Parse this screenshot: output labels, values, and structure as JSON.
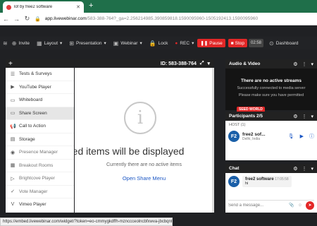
{
  "browser": {
    "tab_title": "lof by free2 software",
    "url_domain": "app.livewebinar.com",
    "url_path": "/583-388-764?_ga=2.256214985.390859818.1590095960-1505192413.1590095960",
    "status_url": "https://embed.livewebinar.com/widget/?token=eo-cmmygkdffh-mznccceolncbfxwva-jbcbqnt#"
  },
  "appbar": {
    "invite": "Invite",
    "layout": "Layout",
    "presentation": "Presentation",
    "webinar": "Webinar",
    "lock": "Lock",
    "rec": "REC",
    "pause": "Pause",
    "stop": "Stop",
    "timer": "02:58",
    "dashboard": "Dashboard"
  },
  "left_panel": {
    "items": [
      {
        "label": "Tests & Surveys",
        "icon": "clipboard-icon"
      },
      {
        "label": "YouTube Player",
        "icon": "youtube-icon"
      },
      {
        "label": "Whiteboard",
        "icon": "whiteboard-icon"
      },
      {
        "label": "Share Screen",
        "icon": "monitor-icon"
      },
      {
        "label": "Call to Action",
        "icon": "megaphone-icon"
      },
      {
        "label": "Storage",
        "icon": "folder-icon"
      },
      {
        "label": "Presence Manager",
        "icon": "eye-icon"
      },
      {
        "label": "Breakout Rooms",
        "icon": "grid-icon"
      },
      {
        "label": "Brightcove Player",
        "icon": "play-circle-icon"
      },
      {
        "label": "Vote Manager",
        "icon": "vote-icon"
      },
      {
        "label": "Vimeo Player",
        "icon": "vimeo-icon"
      }
    ],
    "selected_index": 3
  },
  "main": {
    "room_id": "ID: 583-388-764",
    "shared_title": "red items will be displayed",
    "no_items": "Currently there are no active items",
    "open_share": "Open Share Menu"
  },
  "audio_video": {
    "title": "Audio & Video",
    "line1": "There are no active streams",
    "line2": "Successfully connected to media server",
    "line3": "Please make sure you have permitted",
    "badge": "SEED WORLD"
  },
  "participants": {
    "title": "Participants 2/5",
    "host_label": "HOST (1)",
    "host_initials": "F2",
    "host_name": "free2 sof...",
    "host_location": "Delhi, India"
  },
  "chat": {
    "title": "Chat",
    "initials": "F2",
    "sender": "free2 software",
    "time": "17:05:58",
    "message": "hi",
    "placeholder": "Send a message..."
  },
  "colors": {
    "accent_red": "#e32727",
    "link_blue": "#1a56c4",
    "tab_strip_green": "#1f6f4a"
  }
}
